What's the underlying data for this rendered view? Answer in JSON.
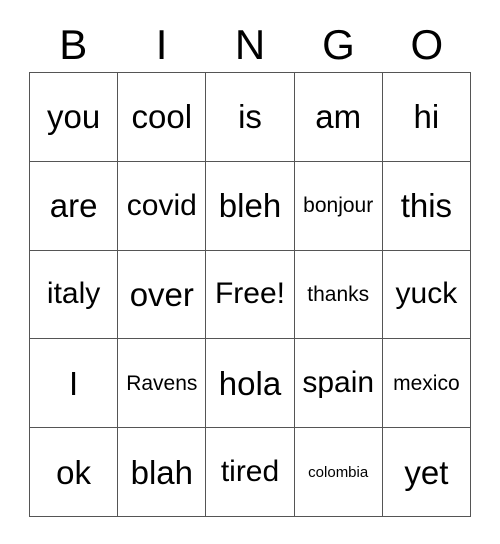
{
  "card": {
    "header_letters": [
      "B",
      "I",
      "N",
      "G",
      "O"
    ],
    "free_space_label": "Free!",
    "text_color": "#000000",
    "border_color": "#555555",
    "background_color": "#ffffff",
    "rows": [
      [
        {
          "text": "you",
          "size": "xl"
        },
        {
          "text": "cool",
          "size": "xl"
        },
        {
          "text": "is",
          "size": "xl"
        },
        {
          "text": "am",
          "size": "xl"
        },
        {
          "text": "hi",
          "size": "xl"
        }
      ],
      [
        {
          "text": "are",
          "size": "xl"
        },
        {
          "text": "covid",
          "size": "lg"
        },
        {
          "text": "bleh",
          "size": "xl"
        },
        {
          "text": "bonjour",
          "size": "md"
        },
        {
          "text": "this",
          "size": "xl"
        }
      ],
      [
        {
          "text": "italy",
          "size": "lg"
        },
        {
          "text": "over",
          "size": "xl"
        },
        {
          "text": "Free!",
          "size": "lg"
        },
        {
          "text": "thanks",
          "size": "md"
        },
        {
          "text": "yuck",
          "size": "lg"
        }
      ],
      [
        {
          "text": "I",
          "size": "xl"
        },
        {
          "text": "Ravens",
          "size": "md"
        },
        {
          "text": "hola",
          "size": "xl"
        },
        {
          "text": "spain",
          "size": "lg"
        },
        {
          "text": "mexico",
          "size": "md"
        }
      ],
      [
        {
          "text": "ok",
          "size": "xl"
        },
        {
          "text": "blah",
          "size": "xl"
        },
        {
          "text": "tired",
          "size": "lg"
        },
        {
          "text": "colombia",
          "size": "xs"
        },
        {
          "text": "yet",
          "size": "xl"
        }
      ]
    ]
  }
}
